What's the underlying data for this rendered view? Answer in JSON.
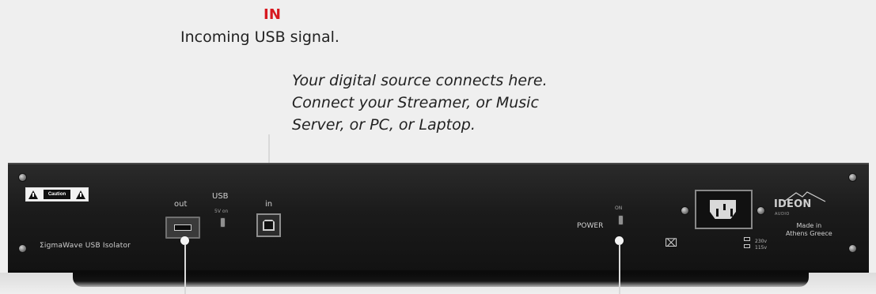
{
  "annotations": {
    "in_title": "IN",
    "in_description": "Incoming USB signal.",
    "source_note_lines": [
      "Your digital source connects here.",
      "Connect your Streamer, or Music",
      "Server, or PC, or Laptop."
    ]
  },
  "device": {
    "caution_text": "Caution",
    "name": "ΣigmaWave USB Isolator",
    "labels": {
      "out": "out",
      "usb": "USB",
      "usb_5v": "5V on",
      "in": "in",
      "power": "POWER",
      "power_on": "ON",
      "voltage_230": "230v",
      "voltage_115": "115v"
    },
    "brand": {
      "name": "IDEON",
      "sub": "AUDIO",
      "made_in_lines": [
        "Made in",
        "Athens Greece"
      ]
    }
  },
  "icons": {
    "warning": "warning-icon",
    "recycle_bin": "recycle-bin-icon",
    "mountain": "mountain-icon"
  },
  "colors": {
    "accent_red": "#d71920",
    "panel": "#1b1b1b",
    "panel_text": "#cfcfcf"
  }
}
